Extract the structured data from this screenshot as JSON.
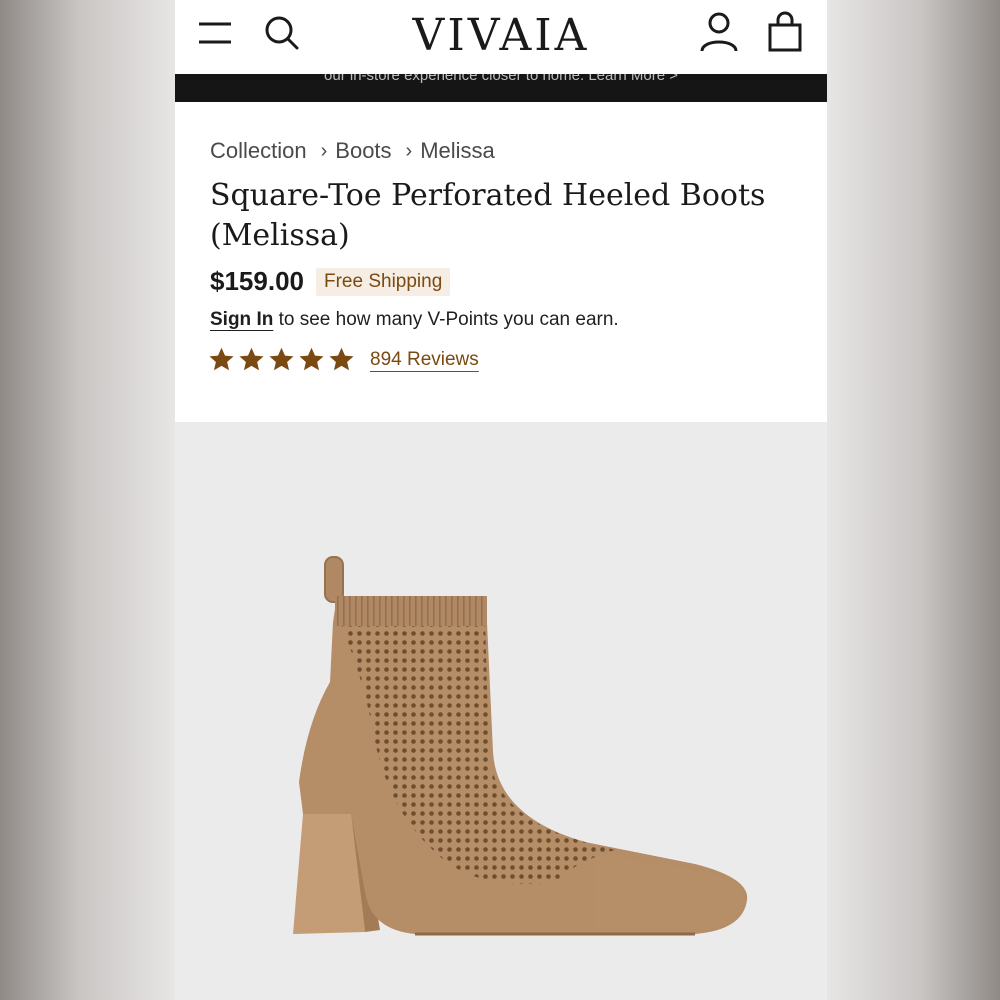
{
  "header": {
    "logo": "VIVAIA",
    "icons": [
      "menu-icon",
      "search-icon",
      "account-icon",
      "bag-icon"
    ]
  },
  "announcement": "our in-store experience closer to home. Learn More >",
  "breadcrumb": {
    "items": [
      "Collection",
      "Boots",
      "Melissa"
    ],
    "separator": "›"
  },
  "product": {
    "title": "Square-Toe Perforated Heeled Boots (Melissa)",
    "price": "$159.00",
    "shipping_badge": "Free Shipping",
    "sign_in_label": "Sign In",
    "points_text": " to see how many V-Points you can earn.",
    "rating": 5,
    "reviews_label": "894 Reviews"
  },
  "colors": {
    "accent_brown": "#7a4a12",
    "boot_tan": "#b58d66",
    "announcement_bg": "#151515"
  }
}
